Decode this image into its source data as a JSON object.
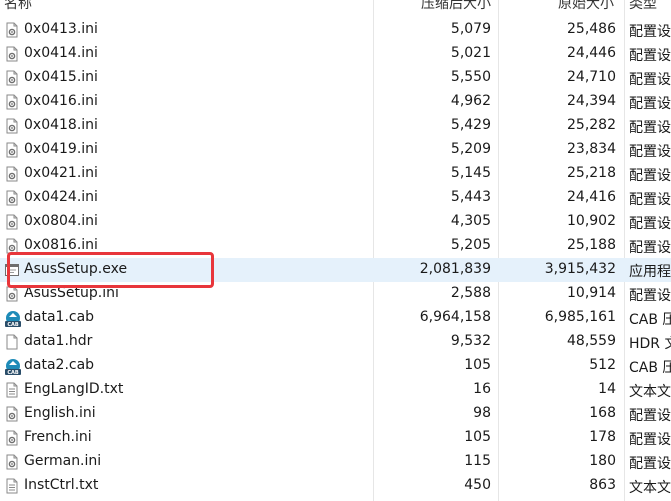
{
  "columns": {
    "name": "名称",
    "compressed": "压缩后大小",
    "original": "原始大小",
    "type": "类型"
  },
  "colors": {
    "selected_row": "#e5f1fb",
    "highlight_box": "#e8363b",
    "cab_icon": "#1e8bb8"
  },
  "files": [
    {
      "name": "0x0413.ini",
      "compressed": "5,079",
      "original": "25,486",
      "type": "配置设",
      "icon": "ini-file-icon"
    },
    {
      "name": "0x0414.ini",
      "compressed": "5,021",
      "original": "24,446",
      "type": "配置设",
      "icon": "ini-file-icon"
    },
    {
      "name": "0x0415.ini",
      "compressed": "5,550",
      "original": "24,710",
      "type": "配置设",
      "icon": "ini-file-icon"
    },
    {
      "name": "0x0416.ini",
      "compressed": "4,962",
      "original": "24,394",
      "type": "配置设",
      "icon": "ini-file-icon"
    },
    {
      "name": "0x0418.ini",
      "compressed": "5,429",
      "original": "25,282",
      "type": "配置设",
      "icon": "ini-file-icon"
    },
    {
      "name": "0x0419.ini",
      "compressed": "5,209",
      "original": "23,834",
      "type": "配置设",
      "icon": "ini-file-icon"
    },
    {
      "name": "0x0421.ini",
      "compressed": "5,145",
      "original": "25,218",
      "type": "配置设",
      "icon": "ini-file-icon"
    },
    {
      "name": "0x0424.ini",
      "compressed": "5,443",
      "original": "24,416",
      "type": "配置设",
      "icon": "ini-file-icon"
    },
    {
      "name": "0x0804.ini",
      "compressed": "4,305",
      "original": "10,902",
      "type": "配置设",
      "icon": "ini-file-icon"
    },
    {
      "name": "0x0816.ini",
      "compressed": "5,205",
      "original": "25,188",
      "type": "配置设",
      "icon": "ini-file-icon"
    },
    {
      "name": "AsusSetup.exe",
      "compressed": "2,081,839",
      "original": "3,915,432",
      "type": "应用程",
      "icon": "exe-file-icon",
      "selected": true
    },
    {
      "name": "AsusSetup.ini",
      "compressed": "2,588",
      "original": "10,914",
      "type": "配置设",
      "icon": "ini-file-icon"
    },
    {
      "name": "data1.cab",
      "compressed": "6,964,158",
      "original": "6,985,161",
      "type": "CAB 压",
      "icon": "cab-file-icon"
    },
    {
      "name": "data1.hdr",
      "compressed": "9,532",
      "original": "48,559",
      "type": "HDR 文",
      "icon": "blank-file-icon"
    },
    {
      "name": "data2.cab",
      "compressed": "105",
      "original": "512",
      "type": "CAB 压",
      "icon": "cab-file-icon"
    },
    {
      "name": "EngLangID.txt",
      "compressed": "16",
      "original": "14",
      "type": "文本文",
      "icon": "txt-file-icon"
    },
    {
      "name": "English.ini",
      "compressed": "98",
      "original": "168",
      "type": "配置设",
      "icon": "ini-file-icon"
    },
    {
      "name": "French.ini",
      "compressed": "105",
      "original": "178",
      "type": "配置设",
      "icon": "ini-file-icon"
    },
    {
      "name": "German.ini",
      "compressed": "115",
      "original": "180",
      "type": "配置设",
      "icon": "ini-file-icon"
    },
    {
      "name": "InstCtrl.txt",
      "compressed": "450",
      "original": "863",
      "type": "文本文",
      "icon": "txt-file-icon"
    }
  ]
}
